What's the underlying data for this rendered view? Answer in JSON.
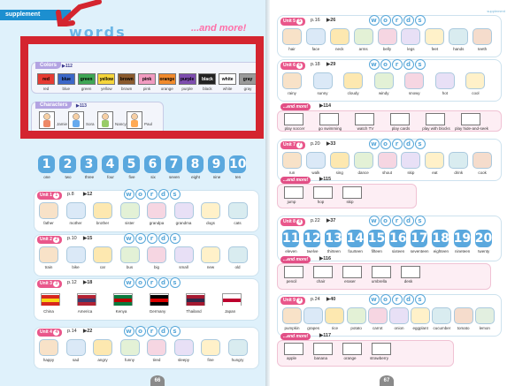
{
  "header": {
    "supplement_tag": "supplement",
    "supplement_tag_right": "supplement",
    "title_words": "words",
    "title_more": "...and more!"
  },
  "colors_panel": {
    "label": "Colors",
    "track": "112",
    "items": [
      {
        "chip": "red",
        "name": "red",
        "color": "#e63b33"
      },
      {
        "chip": "blue",
        "name": "blue",
        "color": "#3b67c8"
      },
      {
        "chip": "green",
        "name": "green",
        "color": "#3ea654"
      },
      {
        "chip": "yellow",
        "name": "yellow",
        "color": "#f5d43a"
      },
      {
        "chip": "brown",
        "name": "brown",
        "color": "#8a5a2e"
      },
      {
        "chip": "pink",
        "name": "pink",
        "color": "#f19bc0"
      },
      {
        "chip": "orange",
        "name": "orange",
        "color": "#f08a2c"
      },
      {
        "chip": "purple",
        "name": "purple",
        "color": "#7d4cae"
      },
      {
        "chip": "black",
        "name": "black",
        "color": "#222222"
      },
      {
        "chip": "white",
        "name": "white",
        "color": "#ffffff"
      },
      {
        "chip": "gray",
        "name": "gray",
        "color": "#9a9a9a"
      }
    ]
  },
  "characters_panel": {
    "label": "Characters",
    "track": "113",
    "items": [
      "Jamie",
      "Sora",
      "Nancy",
      "Paul"
    ]
  },
  "numbers_row": {
    "digits": [
      "1",
      "2",
      "3",
      "4",
      "5",
      "6",
      "7",
      "8",
      "9",
      "10"
    ],
    "names": [
      "one",
      "two",
      "three",
      "four",
      "five",
      "six",
      "seven",
      "eight",
      "nine",
      "ten"
    ]
  },
  "left_units": [
    {
      "unit": "Unit 1",
      "num": "1",
      "page": "p.8",
      "track": "12",
      "captions": [
        "father",
        "mother",
        "brother",
        "sister",
        "grandpa",
        "grandma",
        "dogs",
        "cats"
      ]
    },
    {
      "unit": "Unit 2",
      "num": "2",
      "page": "p.10",
      "track": "15",
      "captions": [
        "train",
        "bike",
        "car",
        "bus",
        "big",
        "small",
        "new",
        "old"
      ]
    },
    {
      "unit": "Unit 3",
      "num": "3",
      "page": "p.12",
      "track": "18",
      "captions": [
        "China",
        "America",
        "Kenya",
        "Germany",
        "Thailand",
        "Japan"
      ]
    },
    {
      "unit": "Unit 4",
      "num": "4",
      "page": "p.14",
      "track": "22",
      "captions": [
        "happy",
        "sad",
        "angry",
        "funny",
        "tired",
        "sleepy",
        "fine",
        "hungry"
      ]
    }
  ],
  "right_units": [
    {
      "unit": "Unit 5",
      "num": "5",
      "page": "p.16",
      "track": "26",
      "captions": [
        "hair",
        "face",
        "neck",
        "arms",
        "belly",
        "legs",
        "feet",
        "hands",
        "teeth"
      ]
    },
    {
      "unit": "Unit 6",
      "num": "6",
      "page": "p.18",
      "track": "29",
      "captions": [
        "rainy",
        "sunny",
        "cloudy",
        "windy",
        "snowy",
        "hot",
        "cool"
      ],
      "more": {
        "track": "114",
        "items": [
          "play soccer",
          "go swimming",
          "watch TV",
          "play cards",
          "play with blocks",
          "play hide-and-seek"
        ]
      }
    },
    {
      "unit": "Unit 7",
      "num": "7",
      "page": "p.20",
      "track": "33",
      "captions": [
        "run",
        "walk",
        "sing",
        "dance",
        "shout",
        "skip",
        "eat",
        "drink",
        "cook"
      ],
      "more": {
        "track": "115",
        "items": [
          "jump",
          "hop",
          "skip"
        ]
      }
    },
    {
      "unit": "Unit 8",
      "num": "8",
      "page": "p.22",
      "track": "37",
      "digits": [
        "11",
        "12",
        "13",
        "14",
        "15",
        "16",
        "17",
        "18",
        "19",
        "20"
      ],
      "captions": [
        "eleven",
        "twelve",
        "thirteen",
        "fourteen",
        "fifteen",
        "sixteen",
        "seventeen",
        "eighteen",
        "nineteen",
        "twenty"
      ],
      "more": {
        "track": "116",
        "items": [
          "pencil",
          "chair",
          "eraser",
          "umbrella",
          "desk"
        ]
      }
    },
    {
      "unit": "Unit 9",
      "num": "9",
      "page": "p.24",
      "track": "40",
      "captions": [
        "pumpkin",
        "grapes",
        "rice",
        "potato",
        "carrot",
        "onion",
        "eggplant",
        "cucumber",
        "tomato",
        "lemon"
      ],
      "more": {
        "track": "117",
        "items": [
          "apple",
          "banana",
          "orange",
          "strawberry"
        ]
      }
    }
  ],
  "page_numbers": {
    "left": "66",
    "right": "67"
  }
}
